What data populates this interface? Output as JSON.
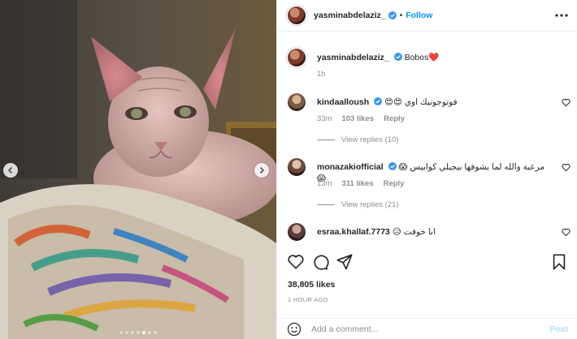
{
  "post": {
    "author": "yasminabdelaziz_",
    "follow_label": "Follow",
    "caption_user": "yasminabdelaziz_",
    "caption_text": "Bobos",
    "caption_emoji": "❤️",
    "caption_age": "1h"
  },
  "comments": [
    {
      "user": "kindaalloush",
      "text": "فوتوجونيك اوي 😍😍",
      "age": "33m",
      "likes": "103 likes",
      "reply_label": "Reply",
      "view_replies": "View replies (10)"
    },
    {
      "user": "monazakiofficial",
      "text": "مرعبة والله لما بشوفها بيجيلي كوابيس 😱😱",
      "age": "13m",
      "likes": "311 likes",
      "reply_label": "Reply",
      "view_replies": "View replies (21)"
    },
    {
      "user": "esraa.khallaf.7773",
      "text": "انا خوفت 😥"
    }
  ],
  "footer": {
    "likes": "38,805 likes",
    "time": "1 HOUR AGO",
    "comment_placeholder": "Add a comment...",
    "post_label": "Post"
  },
  "colors": {
    "accent": "#0095f6",
    "post_disabled": "#b2dffc",
    "muted": "#8e8e8e"
  },
  "icons": [
    "chevron-left-icon",
    "chevron-right-icon",
    "verified-icon",
    "more-icon",
    "heart-icon",
    "comment-icon",
    "share-icon",
    "bookmark-icon",
    "emoji-icon"
  ]
}
